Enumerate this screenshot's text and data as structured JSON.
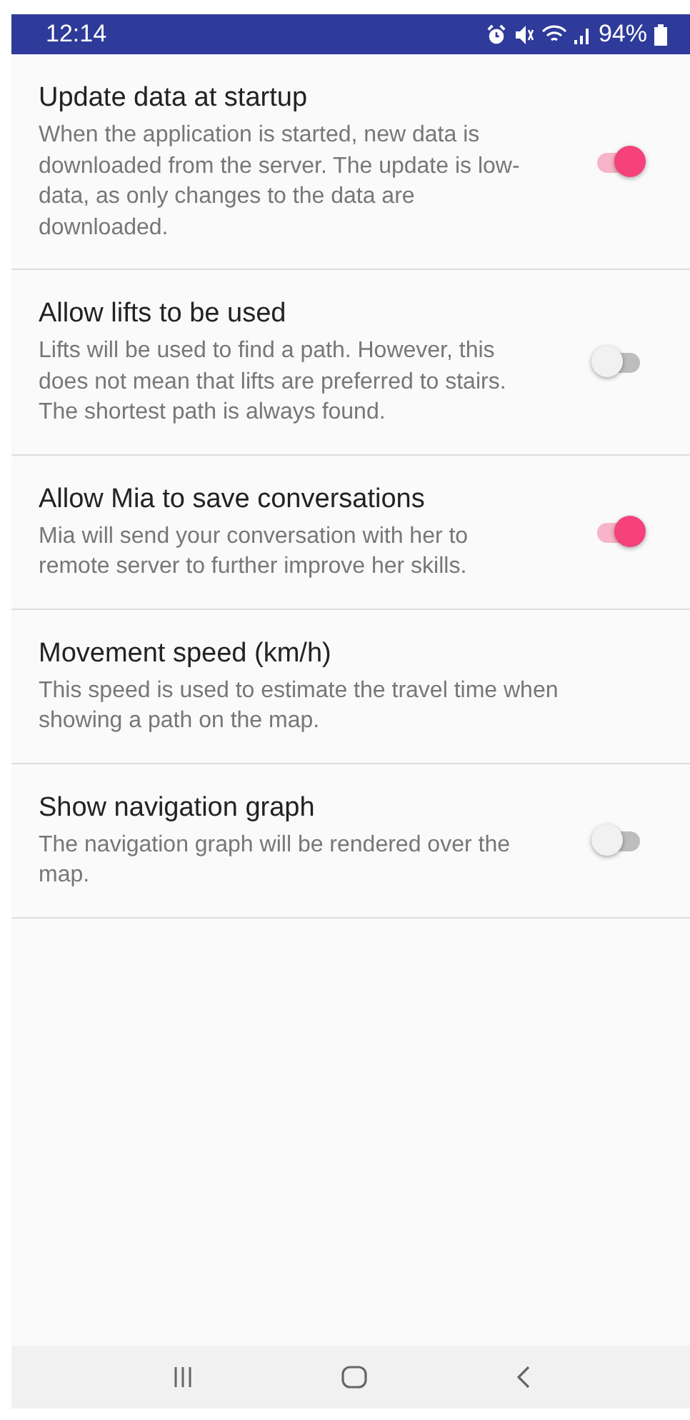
{
  "status_bar": {
    "time": "12:14",
    "battery": "94%"
  },
  "settings": [
    {
      "kind": "switch",
      "title": "Update data at startup",
      "description": "When the application is started, new data is downloaded from the server. The update is low-data, as only changes to the data are downloaded.",
      "on": true
    },
    {
      "kind": "switch",
      "title": "Allow lifts to be used",
      "description": "Lifts will be used to find a path. However, this does not mean that lifts are preferred to stairs. The shortest path is always found.",
      "on": false
    },
    {
      "kind": "switch",
      "title": "Allow Mia to save conversations",
      "description": "Mia will send your conversation with her to remote server to further improve her skills.",
      "on": true
    },
    {
      "kind": "plain",
      "title": "Movement speed (km/h)",
      "description": "This speed is used to estimate the travel time when showing a path on the map."
    },
    {
      "kind": "switch",
      "title": "Show navigation graph",
      "description": "The navigation graph will be rendered over the map.",
      "on": false
    }
  ]
}
